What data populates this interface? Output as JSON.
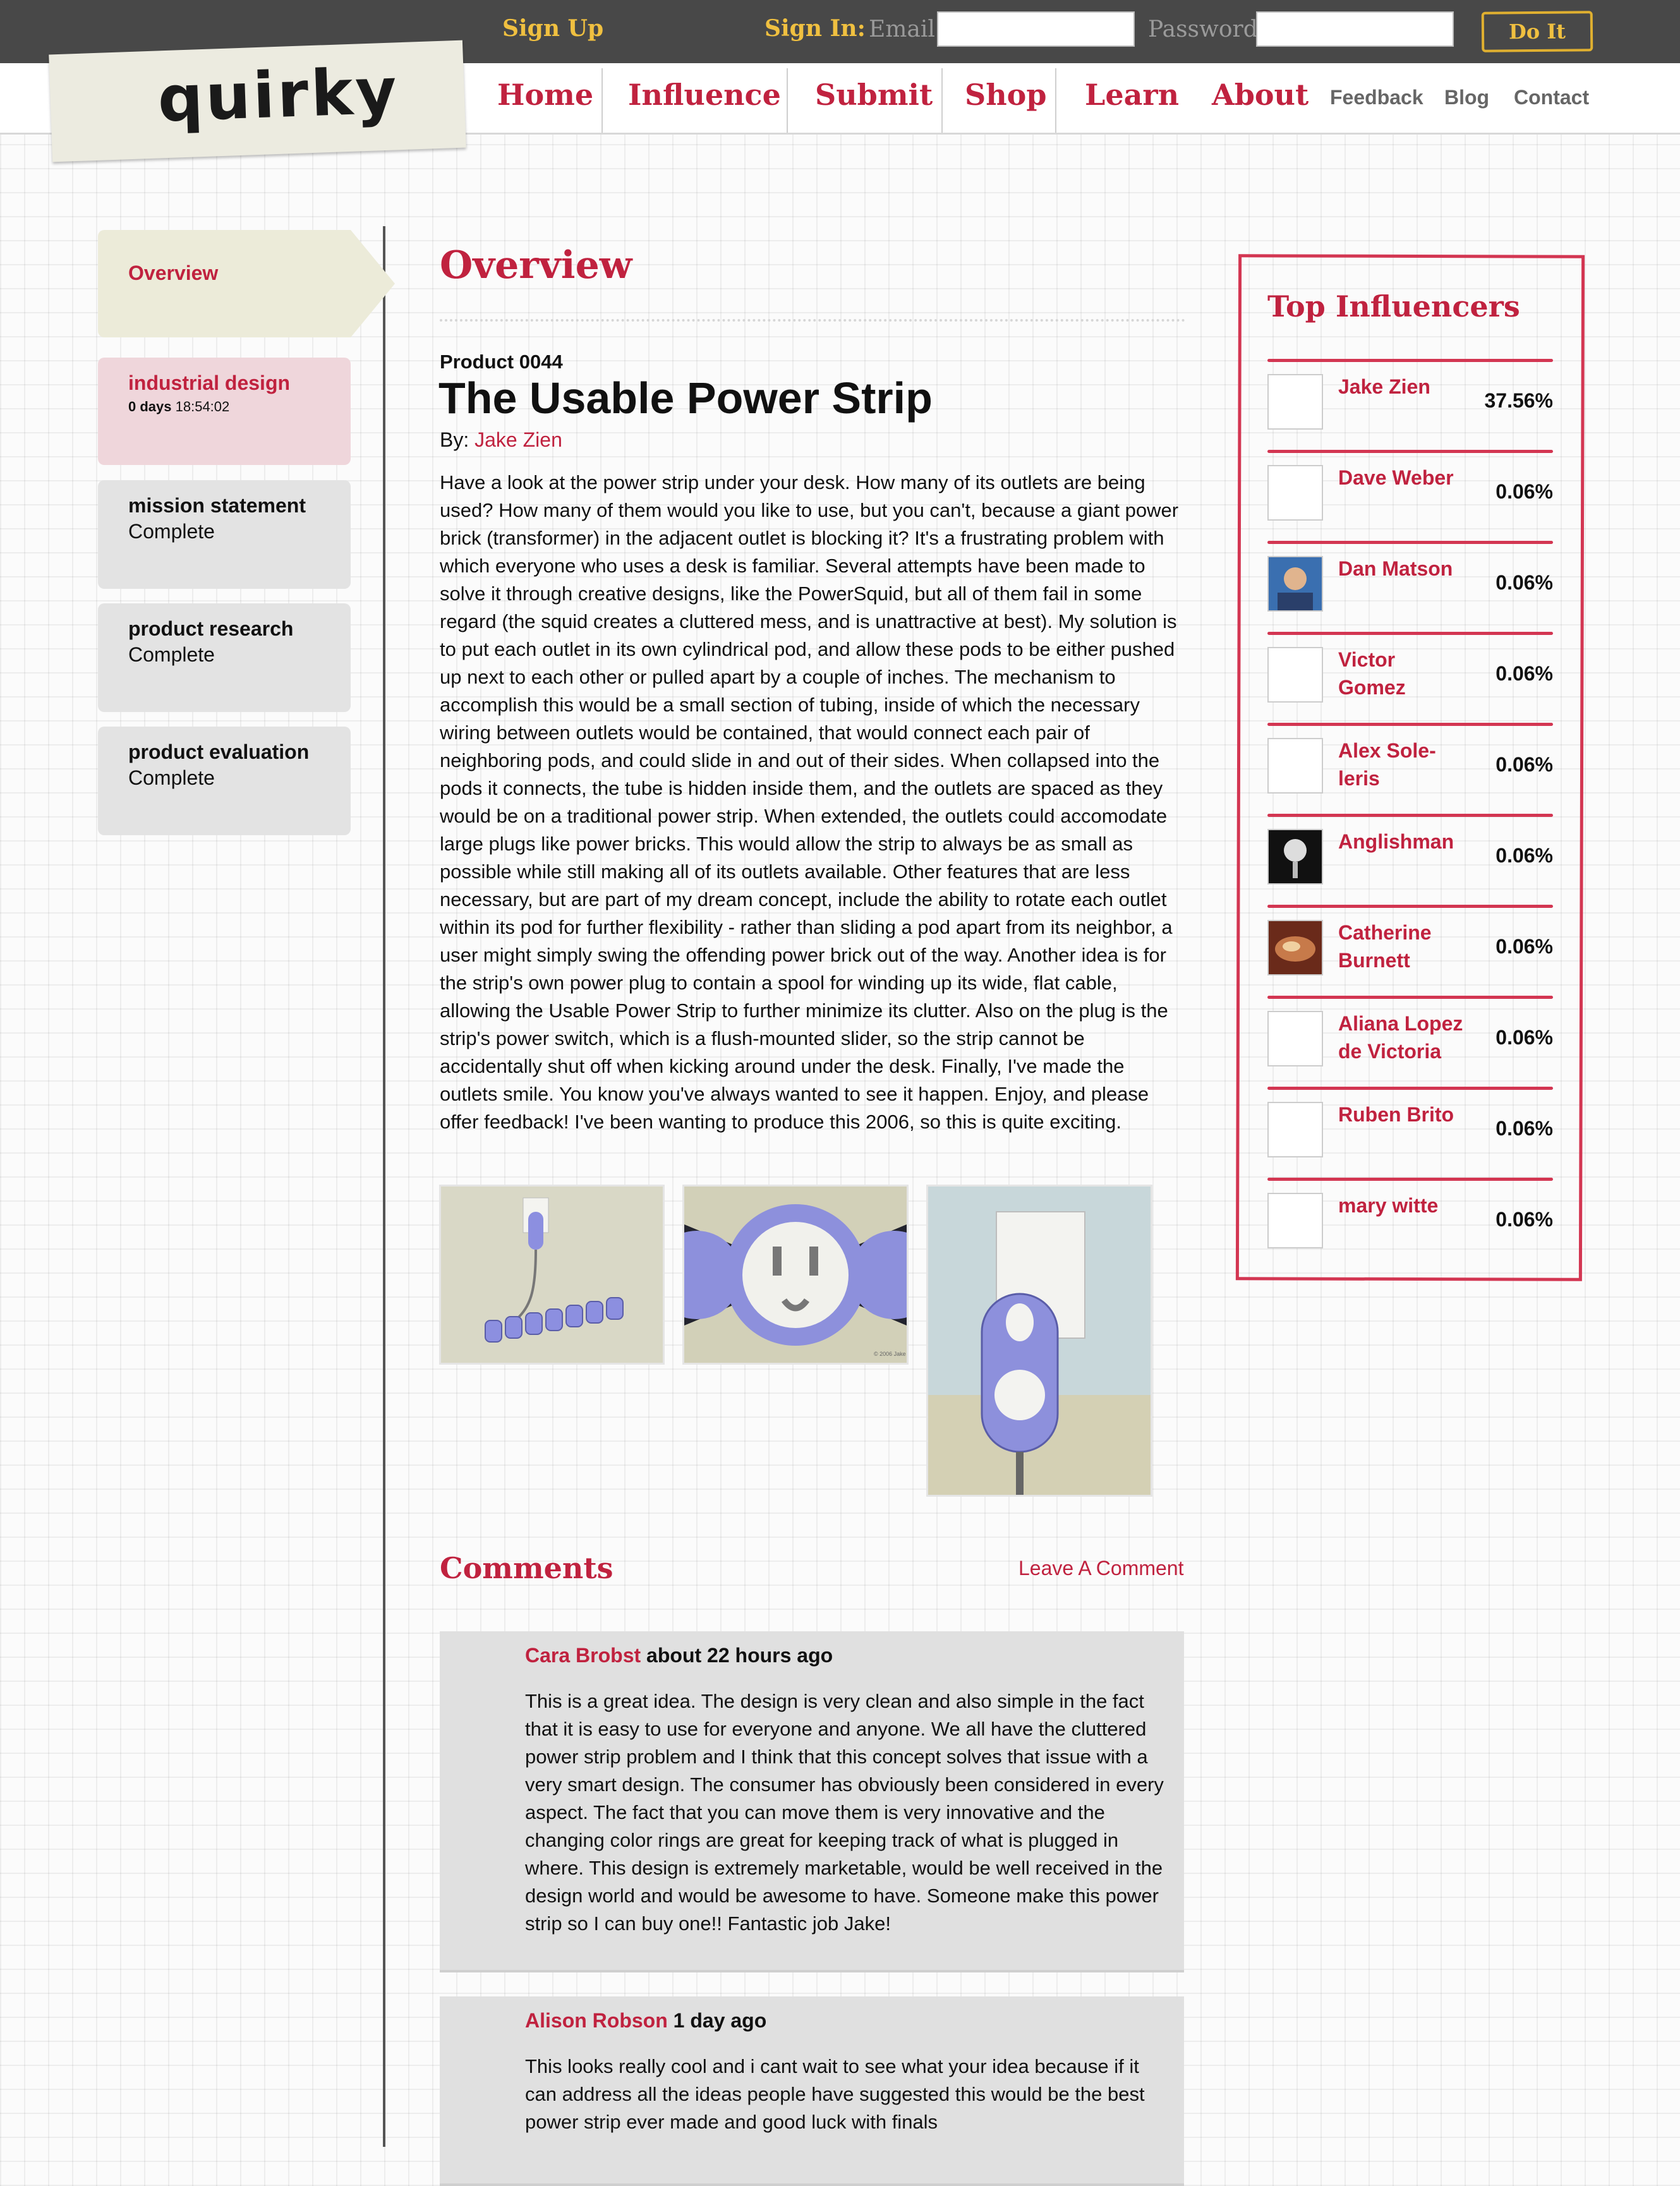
{
  "header": {
    "signup": "Sign Up",
    "signin": "Sign In:",
    "email_label": "Email",
    "password_label": "Password",
    "submit": "Do It"
  },
  "logo": "quirky",
  "nav": {
    "home": "Home",
    "influence": "Influence",
    "submit": "Submit",
    "shop": "Shop",
    "learn": "Learn",
    "about": "About",
    "feedback": "Feedback",
    "blog": "Blog",
    "contact": "Contact"
  },
  "sidebar": {
    "overview": "Overview",
    "items": [
      {
        "title": "industrial design",
        "days": "0 days",
        "time": "18:54:02"
      },
      {
        "title": "mission statement",
        "status": "Complete"
      },
      {
        "title": "product research",
        "status": "Complete"
      },
      {
        "title": "product evaluation",
        "status": "Complete"
      }
    ]
  },
  "main": {
    "heading": "Overview",
    "product_number": "Product 0044",
    "title": "The Usable Power Strip",
    "by_label": "By:",
    "author": "Jake Zien",
    "description": "Have a look at the power strip under your desk. How many of its outlets are being used? How many of them would you like to use, but you can't, because a giant power brick (transformer) in the adjacent outlet is blocking it? It's a frustrating problem with which everyone who uses a desk is familiar. Several attempts have been made to solve it through creative designs, like the PowerSquid, but all of them fail in some regard (the squid creates a cluttered mess, and is unattractive at best). My solution is to put each outlet in its own cylindrical pod, and allow these pods to be either pushed up next to each other or pulled apart by a couple of inches. The mechanism to accomplish this would be a small section of tubing, inside of which the necessary wiring between outlets would be contained, that would connect each pair of neighboring pods, and could slide in and out of their sides. When collapsed into the pods it connects, the tube is hidden inside them, and the outlets are spaced as they would be on a traditional power strip. When extended, the outlets could accomodate large plugs like power bricks. This would allow the strip to always be as small as possible while still making all of its outlets available. Other features that are less necessary, but are part of my dream concept, include the ability to rotate each outlet within its pod for further flexibility - rather than sliding a pod apart from its neighbor, a user might simply swing the offending power brick out of the way. Another idea is for the strip's own power plug to contain a spool for winding up its wide, flat cable, allowing the Usable Power Strip to further minimize its clutter. Also on the plug is the strip's power switch, which is a flush-mounted slider, so the strip cannot be accidentally shut off when kicking around under the desk. Finally, I've made the outlets smile. You know you've always wanted to see it happen. Enjoy, and please offer feedback! I've been wanting to produce this 2006, so this is quite exciting.",
    "image_caption": "© 2006 Jake Zien"
  },
  "comments": {
    "heading": "Comments",
    "leave": "Leave A Comment",
    "list": [
      {
        "author": "Cara Brobst",
        "time": "about 22 hours ago",
        "body": "This is a great idea. The design is very clean and also simple in the fact that it is easy to use for everyone and anyone. We all have the cluttered power strip problem and I think that this concept solves that issue with a very smart design. The consumer has obviously been considered in every aspect. The fact that you can move them is very innovative and the changing color rings are great for keeping track of what is plugged in where. This design is extremely marketable, would be well received in the design world and would be awesome to have. Someone make this power strip so I can buy one!! Fantastic job Jake!"
      },
      {
        "author": "Alison Robson",
        "time": "1 day ago",
        "body": "This looks really cool and i cant wait to see what your idea because if it can address all the ideas people have suggested this would be the best power strip ever made and good luck with finals"
      }
    ]
  },
  "influencers": {
    "title": "Top Influencers",
    "list": [
      {
        "name": "Jake Zien",
        "pct": "37.56%"
      },
      {
        "name": "Dave Weber",
        "pct": "0.06%"
      },
      {
        "name": "Dan Matson",
        "pct": "0.06%"
      },
      {
        "name": "Victor Gomez",
        "pct": "0.06%"
      },
      {
        "name": "Alex Sole-leris",
        "pct": "0.06%"
      },
      {
        "name": "Anglishman",
        "pct": "0.06%"
      },
      {
        "name": "Catherine Burnett",
        "pct": "0.06%"
      },
      {
        "name": "Aliana Lopez de Victoria",
        "pct": "0.06%"
      },
      {
        "name": "Ruben Brito",
        "pct": "0.06%"
      },
      {
        "name": "mary witte",
        "pct": "0.06%"
      }
    ]
  },
  "colors": {
    "brand": "#c0223f",
    "accent": "#f0c040",
    "topbar": "#484848"
  }
}
